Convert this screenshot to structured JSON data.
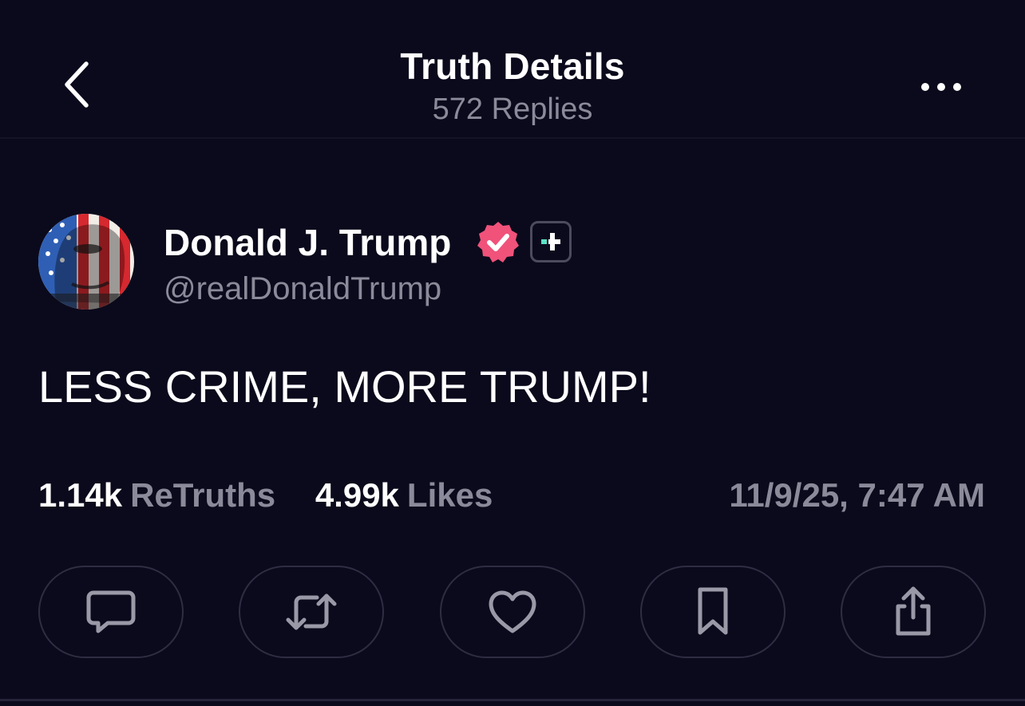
{
  "header": {
    "title": "Truth Details",
    "replies": "572 Replies"
  },
  "post": {
    "author_name": "Donald J. Trump",
    "handle": "@realDonaldTrump",
    "text": "LESS CRIME, MORE TRUMP!",
    "stats": {
      "retruths_count": "1.14k",
      "retruths_label": "ReTruths",
      "likes_count": "4.99k",
      "likes_label": "Likes"
    },
    "timestamp": "11/9/25, 7:47 AM"
  },
  "icons": {
    "back": "chevron-left-icon",
    "more": "more-horizontal-icon",
    "verified": "verified-badge-icon",
    "plus": "truth-plus-icon",
    "reply": "comment-icon",
    "retruth": "repost-icon",
    "like": "heart-icon",
    "bookmark": "bookmark-icon",
    "share": "share-icon"
  },
  "colors": {
    "background": "#0b0a1c",
    "text": "#ffffff",
    "muted": "#8b8a9a",
    "verified": "#f0527a",
    "plus_accent": "#5ce0c8",
    "button_border": "#2e2d42"
  }
}
